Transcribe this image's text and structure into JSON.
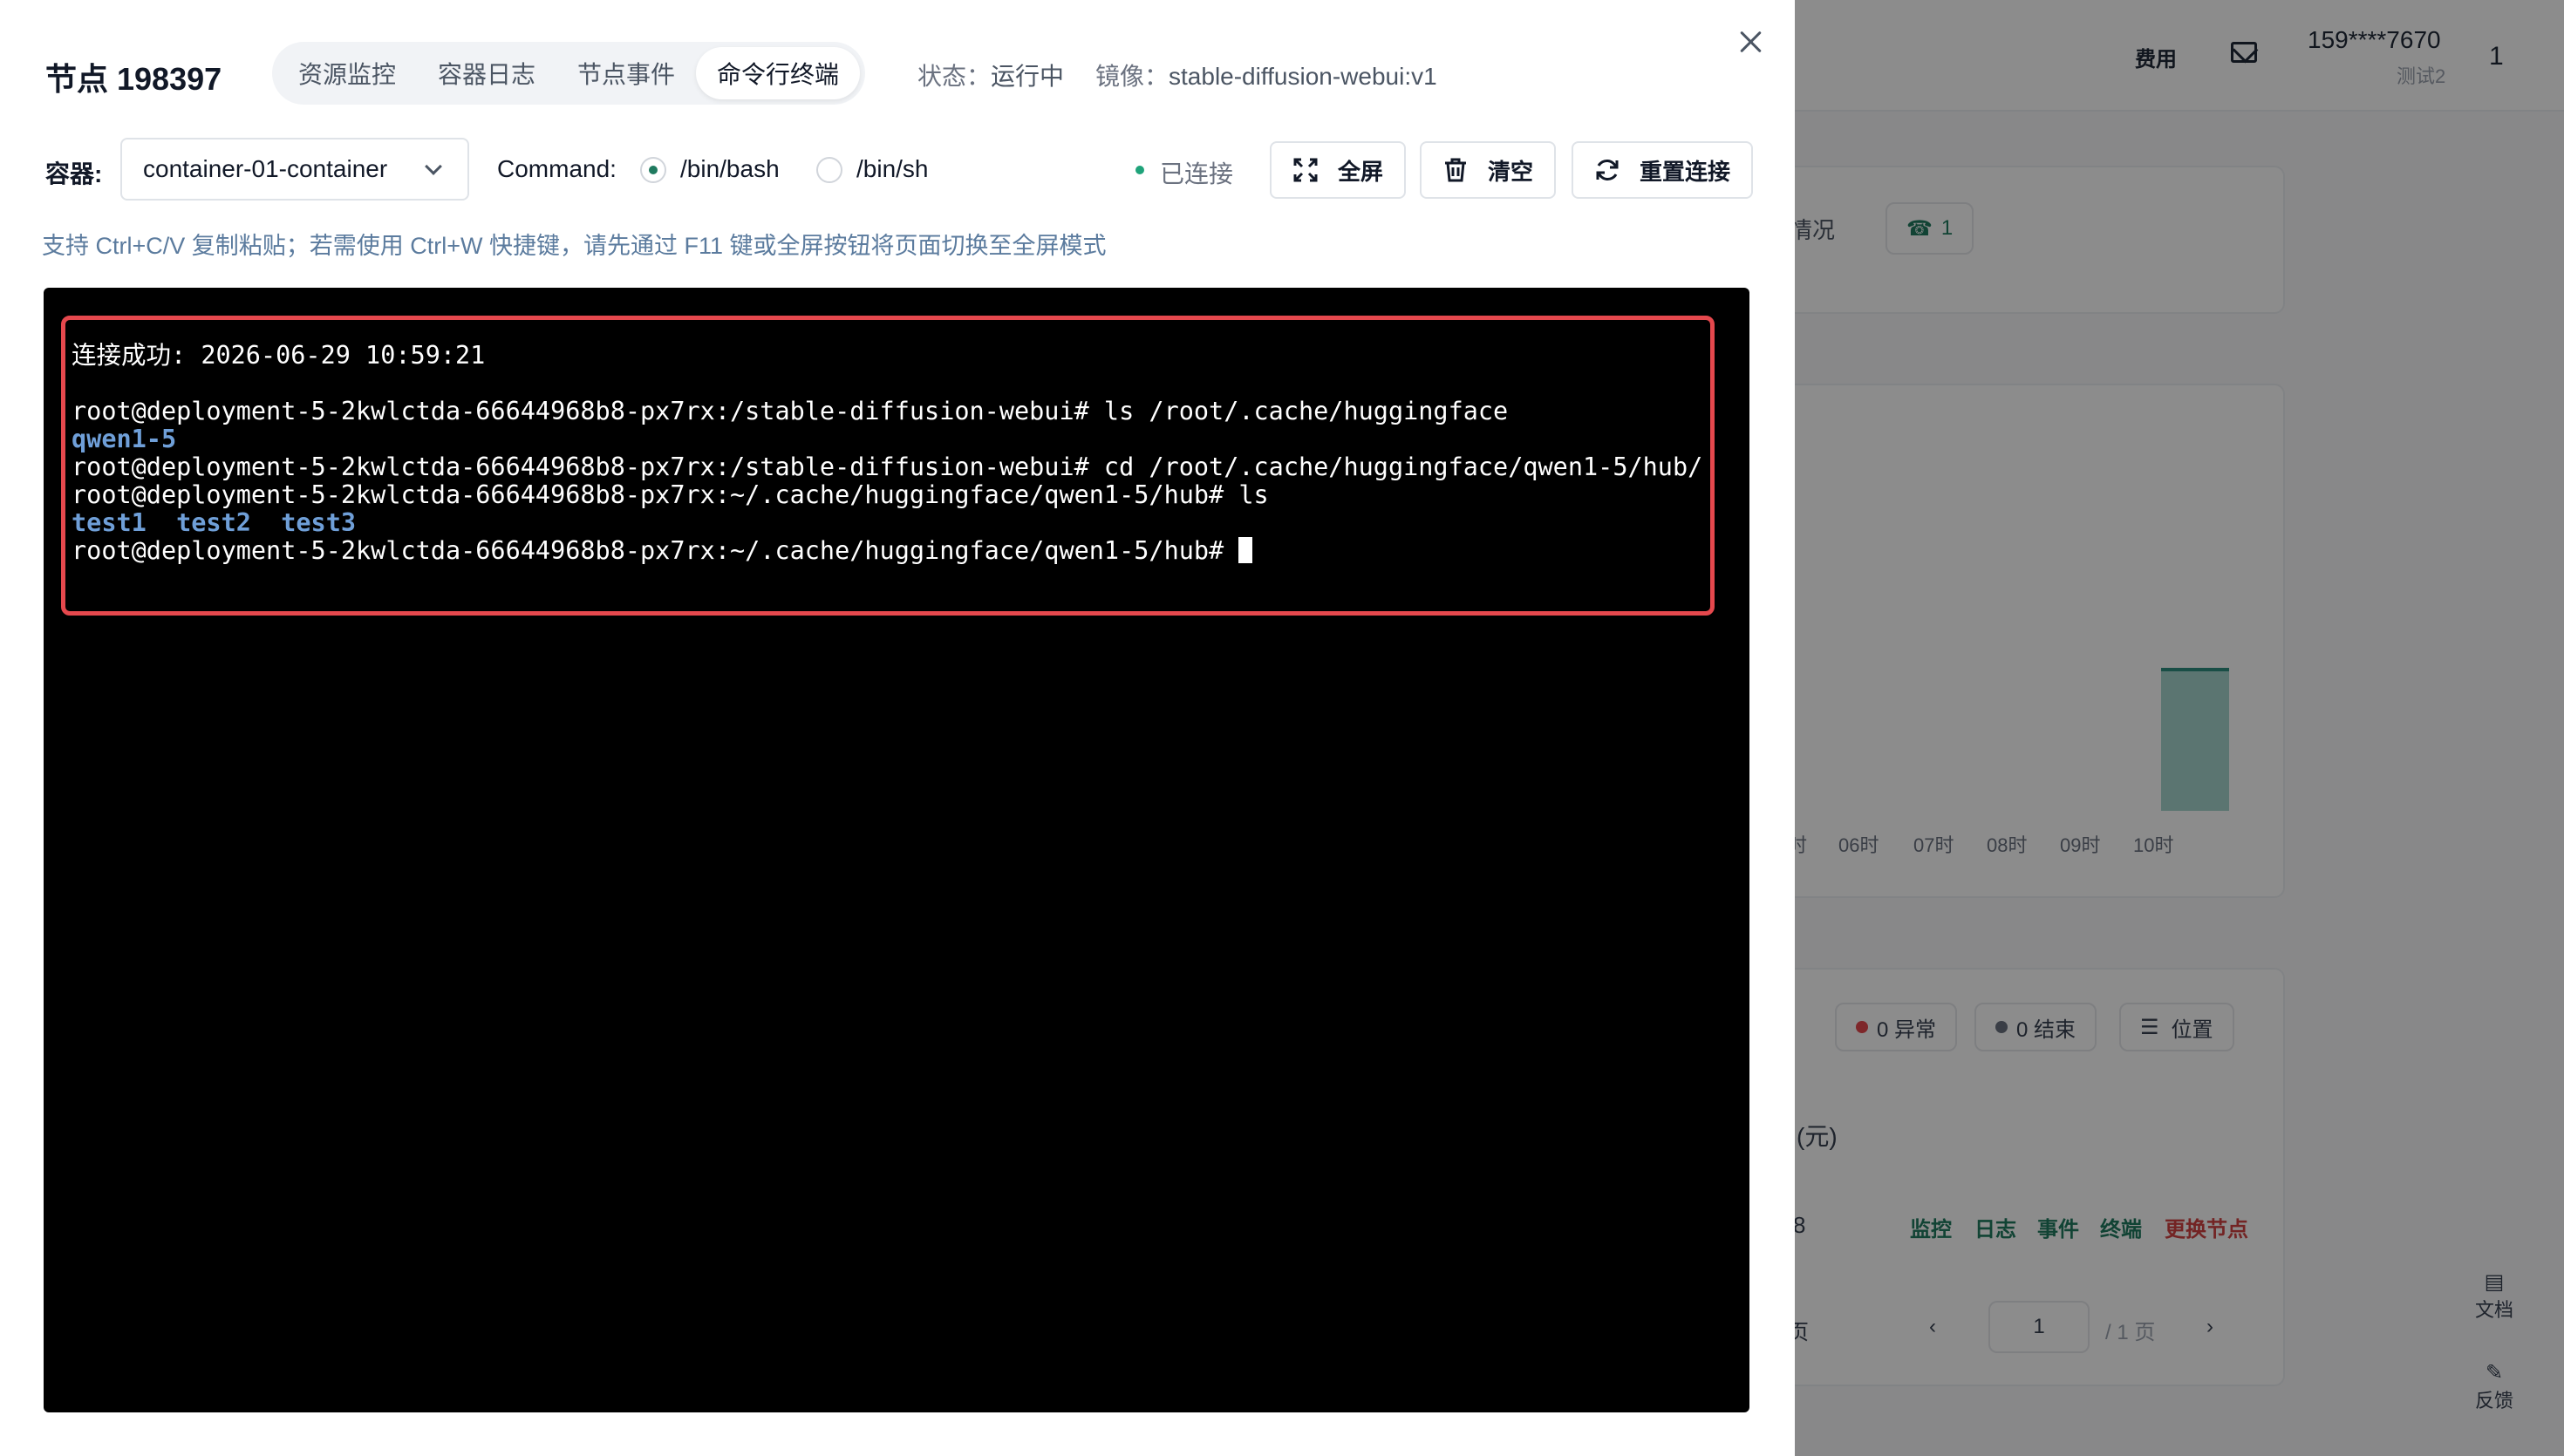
{
  "background": {
    "header": {
      "fee": "费用",
      "phone": "159****7670",
      "user": "测试2",
      "count": "1"
    },
    "card1": {
      "text": "情况",
      "badge": "1"
    },
    "chart_axis": [
      "时",
      "06时",
      "07时",
      "08时",
      "09时",
      "10时"
    ],
    "filters": {
      "error": "0 异常",
      "ended": "0 结束",
      "location": "位置"
    },
    "unit": "(元)",
    "row": {
      "value": "8",
      "links": [
        "监控",
        "日志",
        "事件",
        "终端",
        "更换节点"
      ]
    },
    "pagination": {
      "page_suffix": "页",
      "current": "1",
      "total": "/ 1 页"
    },
    "side": {
      "docs": "文档",
      "feedback": "反馈"
    }
  },
  "modal": {
    "title": "节点 198397",
    "tabs": [
      {
        "label": "资源监控"
      },
      {
        "label": "容器日志"
      },
      {
        "label": "节点事件"
      },
      {
        "label": "命令行终端"
      }
    ],
    "status": {
      "label": "状态：",
      "value": "运行中"
    },
    "image": {
      "label": "镜像：",
      "value": "stable-diffusion-webui:v1"
    },
    "container": {
      "label": "容器:",
      "value": "container-01-container"
    },
    "command": {
      "label": "Command:",
      "options": [
        {
          "label": "/bin/bash"
        },
        {
          "label": "/bin/sh"
        }
      ]
    },
    "connection_status": "已连接",
    "buttons": {
      "fullscreen": "全屏",
      "clear": "清空",
      "reconnect": "重置连接"
    },
    "hint": "支持 Ctrl+C/V 复制粘贴；若需使用 Ctrl+W 快捷键，请先通过 F11 键或全屏按钮将页面切换至全屏模式",
    "colors": {
      "accent": "#1f7a5f",
      "highlight_border": "#e5484d",
      "terminal_bg": "#000000",
      "dir_blue": "#6f9fd8"
    }
  },
  "terminal": {
    "connect_line": "连接成功: 2026-06-29 10:59:21",
    "lines": [
      "root@deployment-5-2kwlctda-66644968b8-px7rx:/stable-diffusion-webui# ls /root/.cache/huggingface",
      "qwen1-5",
      "root@deployment-5-2kwlctda-66644968b8-px7rx:/stable-diffusion-webui# cd /root/.cache/huggingface/qwen1-5/hub/",
      "root@deployment-5-2kwlctda-66644968b8-px7rx:~/.cache/huggingface/qwen1-5/hub# ls",
      "test1  test2  test3",
      "root@deployment-5-2kwlctda-66644968b8-px7rx:~/.cache/huggingface/qwen1-5/hub# "
    ]
  }
}
